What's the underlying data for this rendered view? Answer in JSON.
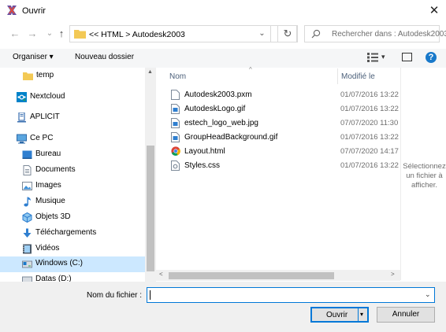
{
  "window": {
    "title": "Ouvrir",
    "close_glyph": "✕"
  },
  "nav": {
    "back_glyph": "←",
    "forward_glyph": "→",
    "up_glyph": "↑",
    "address_text": "<<  HTML  >  Autodesk2003",
    "dropdown_glyph": "⌄",
    "refresh_glyph": "↻",
    "search_placeholder": "Rechercher dans : Autodesk2003"
  },
  "toolbar": {
    "organize": "Organiser ▾",
    "new_folder": "Nouveau dossier",
    "view_dropdown": "▾",
    "help": "?"
  },
  "sidebar": {
    "items": [
      {
        "label": "temp",
        "icon": "folder-icon"
      },
      {
        "label": "Nextcloud",
        "icon": "cloud-icon"
      },
      {
        "label": "APLICIT",
        "icon": "network-icon"
      },
      {
        "label": "Ce PC",
        "icon": "computer-icon"
      },
      {
        "label": "Bureau",
        "icon": "desktop-icon"
      },
      {
        "label": "Documents",
        "icon": "documents-icon"
      },
      {
        "label": "Images",
        "icon": "images-icon"
      },
      {
        "label": "Musique",
        "icon": "music-icon"
      },
      {
        "label": "Objets 3D",
        "icon": "objects3d-icon"
      },
      {
        "label": "Téléchargements",
        "icon": "downloads-icon"
      },
      {
        "label": "Vidéos",
        "icon": "videos-icon"
      },
      {
        "label": "Windows  (C:)",
        "icon": "drive-icon",
        "selected": true
      },
      {
        "label": "Datas (D:)",
        "icon": "drive-icon"
      }
    ]
  },
  "filelist": {
    "columns": {
      "name": "Nom",
      "modified": "Modifié le",
      "sort_glyph": "^"
    },
    "files": [
      {
        "name": "Autodesk2003.pxm",
        "modified": "01/07/2016 13:22",
        "icon": "file-icon"
      },
      {
        "name": "AutodeskLogo.gif",
        "modified": "01/07/2016 13:22",
        "icon": "image-file-icon"
      },
      {
        "name": "estech_logo_web.jpg",
        "modified": "07/07/2020 11:30",
        "icon": "image-file-icon"
      },
      {
        "name": "GroupHeadBackground.gif",
        "modified": "01/07/2016 13:22",
        "icon": "image-file-icon"
      },
      {
        "name": "Layout.html",
        "modified": "07/07/2020 14:17",
        "icon": "chrome-icon"
      },
      {
        "name": "Styles.css",
        "modified": "01/07/2016 13:22",
        "icon": "css-file-icon"
      }
    ],
    "scroll_left": "<",
    "scroll_right": ">"
  },
  "preview": {
    "text": "Sélectionnez un fichier à afficher."
  },
  "footer": {
    "filename_label": "Nom du fichier :",
    "filename_value": "",
    "filename_dropdown": "⌄",
    "open_button": "Ouvrir",
    "open_dropdown": "▾",
    "cancel_button": "Annuler"
  },
  "colors": {
    "accent": "#0078d7",
    "selection": "#cce8ff",
    "folder": "#f3c955"
  }
}
